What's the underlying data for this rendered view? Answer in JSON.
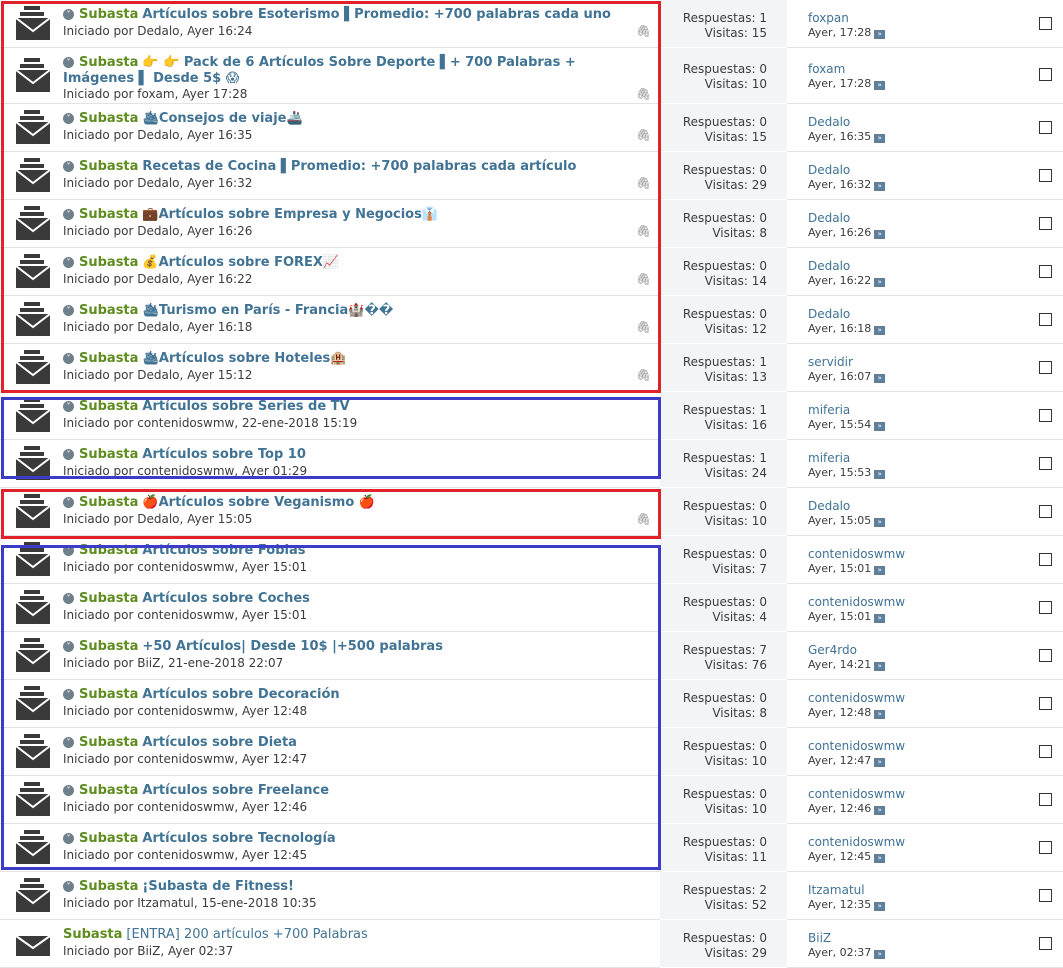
{
  "labels": {
    "replies": "Respuestas:",
    "views": "Visitas:",
    "goto_icon": "goto-last-post-icon"
  },
  "threads": [
    {
      "prefix": "Subasta",
      "title": "Artículos sobre Esoterismo ▌Promedio: +700 palabras cada uno",
      "meta": "Iniciado por Dedalo, Ayer 16:24",
      "replies": "1",
      "views": "15",
      "last_user": "foxpan",
      "last_date": "Ayer, 17:28",
      "attach": true
    },
    {
      "prefix": "Subasta",
      "title": "👉 👉 Pack de 6 Artículos Sobre Deporte ▌+ 700 Palabras + Imágenes ▌ Desde 5$ 😱",
      "meta": "Iniciado por foxam, Ayer 17:28",
      "replies": "0",
      "views": "10",
      "last_user": "foxam",
      "last_date": "Ayer, 17:28",
      "attach": true,
      "tall": true
    },
    {
      "prefix": "Subasta",
      "title": "🛳Consejos de viaje🚢",
      "meta": "Iniciado por Dedalo, Ayer 16:35",
      "replies": "0",
      "views": "15",
      "last_user": "Dedalo",
      "last_date": "Ayer, 16:35",
      "attach": true
    },
    {
      "prefix": "Subasta",
      "title": "Recetas de Cocina ▌Promedio: +700 palabras cada artículo",
      "meta": "Iniciado por Dedalo, Ayer 16:32",
      "replies": "0",
      "views": "29",
      "last_user": "Dedalo",
      "last_date": "Ayer, 16:32",
      "attach": true
    },
    {
      "prefix": "Subasta",
      "title": "💼Artículos sobre Empresa y Negocios👔",
      "meta": "Iniciado por Dedalo, Ayer 16:26",
      "replies": "0",
      "views": "8",
      "last_user": "Dedalo",
      "last_date": "Ayer, 16:26",
      "attach": true
    },
    {
      "prefix": "Subasta",
      "title": "💰Artículos sobre FOREX📈",
      "meta": "Iniciado por Dedalo, Ayer 16:22",
      "replies": "0",
      "views": "14",
      "last_user": "Dedalo",
      "last_date": "Ayer, 16:22",
      "attach": true
    },
    {
      "prefix": "Subasta",
      "title": "🛳Turismo en París - Francia🏰��",
      "meta": "Iniciado por Dedalo, Ayer 16:18",
      "replies": "0",
      "views": "12",
      "last_user": "Dedalo",
      "last_date": "Ayer, 16:18",
      "attach": true
    },
    {
      "prefix": "Subasta",
      "title": "🛳Artículos sobre Hoteles🏨",
      "meta": "Iniciado por Dedalo, Ayer 15:12",
      "replies": "1",
      "views": "13",
      "last_user": "servidir",
      "last_date": "Ayer, 16:07",
      "attach": true
    },
    {
      "prefix": "Subasta",
      "title": "Artículos sobre Series de TV",
      "meta": "Iniciado por contenidoswmw, 22-ene-2018 15:19",
      "replies": "1",
      "views": "16",
      "last_user": "miferia",
      "last_date": "Ayer, 15:54",
      "attach": false
    },
    {
      "prefix": "Subasta",
      "title": "Artículos sobre Top 10",
      "meta": "Iniciado por contenidoswmw, Ayer 01:29",
      "replies": "1",
      "views": "24",
      "last_user": "miferia",
      "last_date": "Ayer, 15:53",
      "attach": false
    },
    {
      "prefix": "Subasta",
      "title": "🍎Artículos sobre Veganismo 🍎",
      "meta": "Iniciado por Dedalo, Ayer 15:05",
      "replies": "0",
      "views": "10",
      "last_user": "Dedalo",
      "last_date": "Ayer, 15:05",
      "attach": true
    },
    {
      "prefix": "Subasta",
      "title": "Artículos sobre Fobias",
      "meta": "Iniciado por contenidoswmw, Ayer 15:01",
      "replies": "0",
      "views": "7",
      "last_user": "contenidoswmw",
      "last_date": "Ayer, 15:01",
      "attach": false
    },
    {
      "prefix": "Subasta",
      "title": "Artículos sobre Coches",
      "meta": "Iniciado por contenidoswmw, Ayer 15:01",
      "replies": "0",
      "views": "4",
      "last_user": "contenidoswmw",
      "last_date": "Ayer, 15:01",
      "attach": false
    },
    {
      "prefix": "Subasta",
      "title": "+50 Artículos| Desde 10$ |+500 palabras",
      "meta": "Iniciado por BiiZ, 21-ene-2018 22:07",
      "replies": "7",
      "views": "76",
      "last_user": "Ger4rdo",
      "last_date": "Ayer, 14:21",
      "attach": false
    },
    {
      "prefix": "Subasta",
      "title": "Artículos sobre Decoración",
      "meta": "Iniciado por contenidoswmw, Ayer 12:48",
      "replies": "0",
      "views": "8",
      "last_user": "contenidoswmw",
      "last_date": "Ayer, 12:48",
      "attach": false
    },
    {
      "prefix": "Subasta",
      "title": "Artículos sobre Dieta",
      "meta": "Iniciado por contenidoswmw, Ayer 12:47",
      "replies": "0",
      "views": "10",
      "last_user": "contenidoswmw",
      "last_date": "Ayer, 12:47",
      "attach": false
    },
    {
      "prefix": "Subasta",
      "title": "Artículos sobre Freelance",
      "meta": "Iniciado por contenidoswmw, Ayer 12:46",
      "replies": "0",
      "views": "10",
      "last_user": "contenidoswmw",
      "last_date": "Ayer, 12:46",
      "attach": false
    },
    {
      "prefix": "Subasta",
      "title": "Artículos sobre Tecnología",
      "meta": "Iniciado por contenidoswmw, Ayer 12:45",
      "replies": "0",
      "views": "11",
      "last_user": "contenidoswmw",
      "last_date": "Ayer, 12:45",
      "attach": false
    },
    {
      "prefix": "Subasta",
      "title": "¡Subasta de Fitness!",
      "meta": "Iniciado por Itzamatul, 15-ene-2018 10:35",
      "replies": "2",
      "views": "52",
      "last_user": "Itzamatul",
      "last_date": "Ayer, 12:35",
      "attach": false
    },
    {
      "prefix": "Subasta",
      "title": "[ENTRA] 200 artículos +700 Palabras",
      "meta": "Iniciado por BiiZ, Ayer 02:37",
      "replies": "0",
      "views": "29",
      "last_user": "BiiZ",
      "last_date": "Ayer, 02:37",
      "attach": false,
      "plain": true
    }
  ],
  "highlight_colors": {
    "red": "#e0232a",
    "blue": "#3c3cc8"
  },
  "colors": {
    "prefix": "#5f8c1f",
    "link": "#417394",
    "stats_bg": "#f2f4f6"
  }
}
